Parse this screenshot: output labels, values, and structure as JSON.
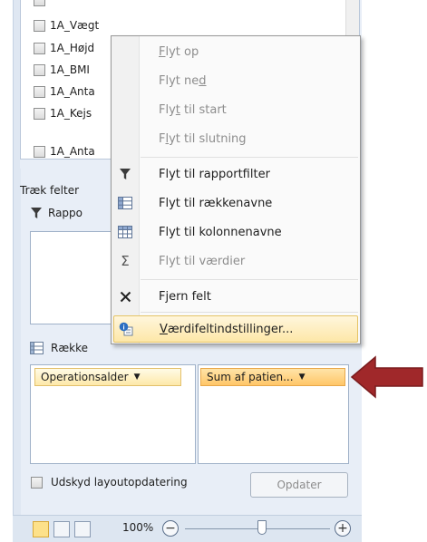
{
  "field_list": {
    "fields": [
      "1A_Vægt",
      "1A_Højd",
      "1A_BMI",
      "1A_Anta",
      "1A_Kejs",
      "1A_Anta"
    ]
  },
  "drag_label": "Træk felter",
  "report_filter_area": {
    "label": "Rappo"
  },
  "row_labels_area": {
    "label": "Række",
    "chip": "Operationsalder"
  },
  "values_area": {
    "chip": "Sum af patien..."
  },
  "context_menu": {
    "items": [
      {
        "label": "Flyt op",
        "accel": "F",
        "rest": "lyt op",
        "enabled": false,
        "icon": "none"
      },
      {
        "label": "Flyt ned",
        "pre": "Flyt ne",
        "accel": "d",
        "enabled": false,
        "icon": "none"
      },
      {
        "label": "Flyt til start",
        "pre": "Fly",
        "accel": "t",
        "rest": " til start",
        "enabled": false,
        "icon": "none"
      },
      {
        "label": "Flyt til slutning",
        "pre": "F",
        "accel": "l",
        "rest": "yt til slutning",
        "enabled": false,
        "icon": "none"
      },
      {
        "label": "Flyt til rapportfilter",
        "enabled": true,
        "icon": "filter-icon"
      },
      {
        "label": "Flyt til rækkenavne",
        "enabled": true,
        "icon": "row-labels-icon"
      },
      {
        "label": "Flyt til kolonnenavne",
        "enabled": true,
        "icon": "column-labels-icon"
      },
      {
        "label": "Flyt til værdier",
        "enabled": false,
        "icon": "sigma-icon"
      },
      {
        "label": "Fjern felt",
        "enabled": true,
        "icon": "remove-icon"
      },
      {
        "label": "Værdifeltindstillinger...",
        "accel": "V",
        "rest": "ærdifeltindstillinger...",
        "enabled": true,
        "icon": "value-settings-icon",
        "highlighted": true
      }
    ]
  },
  "defer_update": {
    "label": "Udskyd layoutopdatering",
    "checked": false
  },
  "update_button": {
    "label": "Opdater",
    "enabled": false
  },
  "status_bar": {
    "zoom": "100%"
  },
  "colors": {
    "chip_fill": "#fde9a9",
    "active_chip": "#ffc668",
    "arrow": "#a0282a",
    "highlight": "#fde7a8"
  }
}
